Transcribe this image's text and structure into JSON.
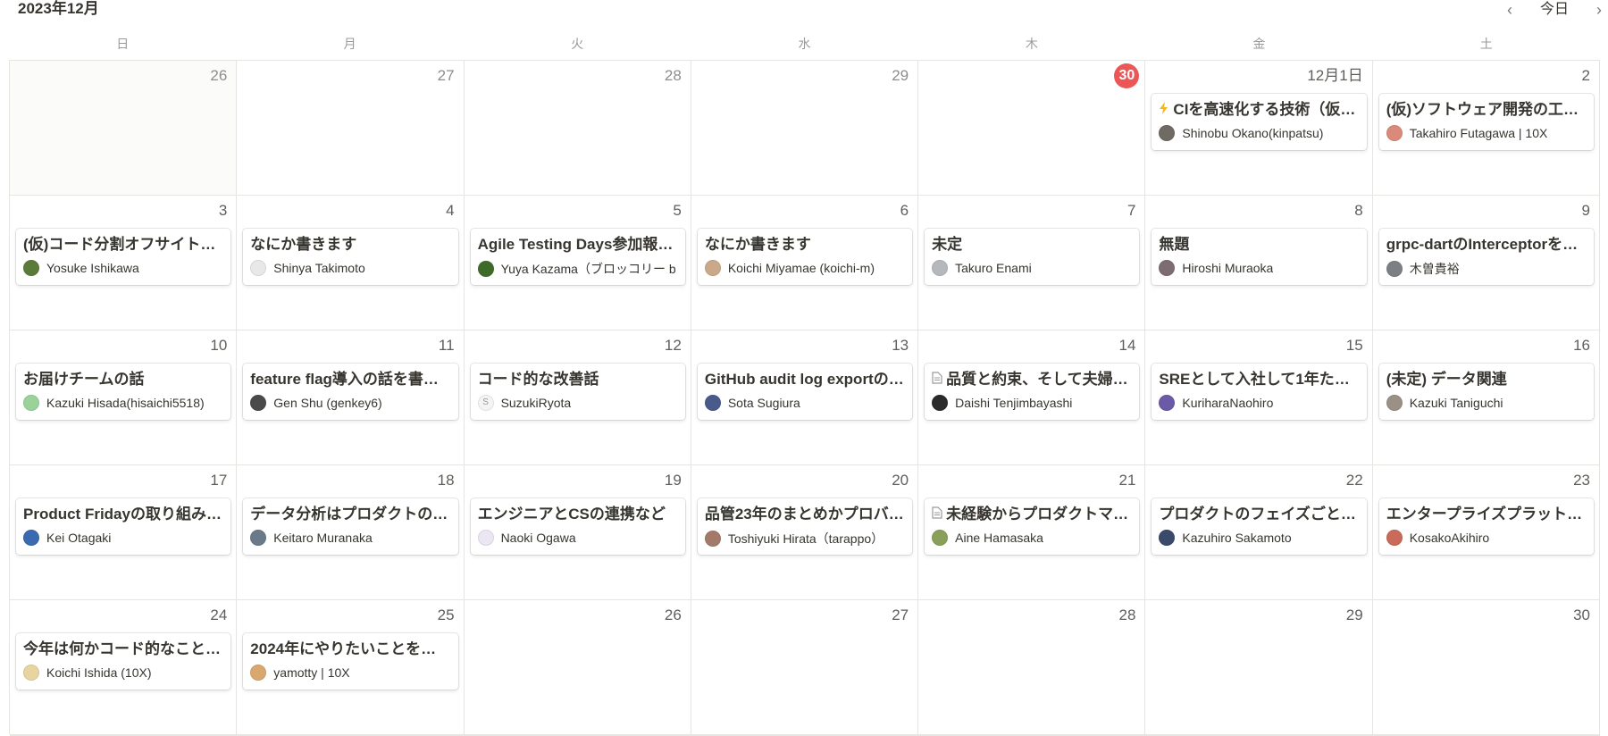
{
  "header": {
    "month_title": "2023年12月",
    "today_label": "今日",
    "prev_icon": "chevron-left-icon",
    "next_icon": "chevron-right-icon"
  },
  "weekdays": [
    "日",
    "月",
    "火",
    "水",
    "木",
    "金",
    "土"
  ],
  "colors": {
    "today_badge": "#eb5757",
    "border": "#e6e5e2"
  },
  "weeks": [
    {
      "days": [
        {
          "day": "26",
          "other": true
        },
        {
          "day": "27",
          "other": true
        },
        {
          "day": "28",
          "other": true
        },
        {
          "day": "29",
          "other": true
        },
        {
          "day": "30",
          "other": true,
          "today": true
        },
        {
          "day": "12月1日",
          "event": {
            "title": "CIを高速化する技術（仮…",
            "icon": "bolt",
            "author": "Shinobu Okano(kinpatsu)",
            "avatar": "#6f6a64"
          }
        },
        {
          "day": "2",
          "event": {
            "title": "(仮)ソフトウェア開発の工…",
            "author": "Takahiro Futagawa | 10X",
            "avatar": "#d98a7a"
          }
        }
      ]
    },
    {
      "days": [
        {
          "day": "3",
          "event": {
            "title": "(仮)コード分割オフサイト…",
            "author": "Yosuke Ishikawa",
            "avatar": "#5c7a3a"
          }
        },
        {
          "day": "4",
          "event": {
            "title": "なにか書きます",
            "author": "Shinya Takimoto",
            "avatar": "#e8e8e8"
          }
        },
        {
          "day": "5",
          "event": {
            "title": "Agile Testing Days参加報…",
            "author": "Yuya Kazama（ブロッコリー b",
            "avatar": "#3f6b2a"
          }
        },
        {
          "day": "6",
          "event": {
            "title": "なにか書きます",
            "author": "Koichi Miyamae (koichi-m)",
            "avatar": "#c9a98a"
          }
        },
        {
          "day": "7",
          "event": {
            "title": "未定",
            "author": "Takuro Enami",
            "avatar": "#b5b8bd"
          }
        },
        {
          "day": "8",
          "event": {
            "title": "無題",
            "author": "Hiroshi Muraoka",
            "avatar": "#7d6d73"
          }
        },
        {
          "day": "9",
          "event": {
            "title": "grpc-dartのInterceptorを…",
            "author": "木曽貴裕",
            "avatar": "#7c7f84"
          }
        }
      ]
    },
    {
      "days": [
        {
          "day": "10",
          "event": {
            "title": "お届けチームの話",
            "author": "Kazuki Hisada(hisaichi5518)",
            "avatar": "#9ad29a"
          }
        },
        {
          "day": "11",
          "event": {
            "title": "feature flag導入の話を書…",
            "author": "Gen Shu (genkey6)",
            "avatar": "#4a4a4a"
          }
        },
        {
          "day": "12",
          "event": {
            "title": "コード的な改善話",
            "author": "SuzukiRyota",
            "avatar": "#f4f4f4",
            "letter": "S"
          }
        },
        {
          "day": "13",
          "event": {
            "title": "GitHub audit log exportの…",
            "author": "Sota Sugiura",
            "avatar": "#4a5a8a"
          }
        },
        {
          "day": "14",
          "event": {
            "title": "品質と約束、そして夫婦…",
            "icon": "doc",
            "author": "Daishi Tenjimbayashi",
            "avatar": "#2a2a2a"
          }
        },
        {
          "day": "15",
          "event": {
            "title": "SREとして入社して1年たち…",
            "author": "KuriharaNaohiro",
            "avatar": "#6a5aa8"
          }
        },
        {
          "day": "16",
          "event": {
            "title": "(未定) データ関連",
            "author": "Kazuki Taniguchi",
            "avatar": "#9a9085"
          }
        }
      ]
    },
    {
      "days": [
        {
          "day": "17",
          "event": {
            "title": "Product Fridayの取り組み…",
            "author": "Kei Otagaki",
            "avatar": "#3a6ab0"
          }
        },
        {
          "day": "18",
          "event": {
            "title": "データ分析はプロダクトの…",
            "author": "Keitaro Muranaka",
            "avatar": "#6a7a8a"
          }
        },
        {
          "day": "19",
          "event": {
            "title": "エンジニアとCSの連携など",
            "author": "Naoki Ogawa",
            "avatar": "#eae6f2"
          }
        },
        {
          "day": "20",
          "event": {
            "title": "品管23年のまとめかプロバ…",
            "author": "Toshiyuki Hirata（tarappo）",
            "avatar": "#a37a6a"
          }
        },
        {
          "day": "21",
          "event": {
            "title": "未経験からプロダクトマ…",
            "icon": "doc",
            "author": "Aine Hamasaka",
            "avatar": "#8aa05a"
          }
        },
        {
          "day": "22",
          "event": {
            "title": "プロダクトのフェイズごと…",
            "author": "Kazuhiro Sakamoto",
            "avatar": "#3a4a6a"
          }
        },
        {
          "day": "23",
          "event": {
            "title": "エンタープライズプラット…",
            "author": "KosakoAkihiro",
            "avatar": "#c96a5a"
          }
        }
      ]
    },
    {
      "days": [
        {
          "day": "24",
          "event": {
            "title": "今年は何かコード的なこと…",
            "author": "Koichi Ishida (10X)",
            "avatar": "#e8d4a0"
          }
        },
        {
          "day": "25",
          "event": {
            "title": "2024年にやりたいことを…",
            "author": "yamotty | 10X",
            "avatar": "#d9a870"
          }
        },
        {
          "day": "26"
        },
        {
          "day": "27"
        },
        {
          "day": "28"
        },
        {
          "day": "29"
        },
        {
          "day": "30"
        }
      ]
    }
  ]
}
